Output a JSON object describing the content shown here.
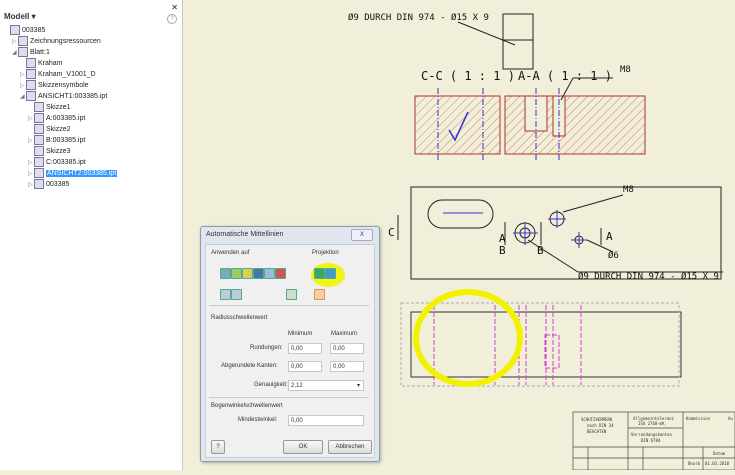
{
  "tree": {
    "header": "Modell",
    "items": [
      {
        "label": "003385",
        "indent": 0
      },
      {
        "label": "Zeichnungsressourcen",
        "indent": 1
      },
      {
        "label": "Blatt:1",
        "indent": 1
      },
      {
        "label": "Kraham",
        "indent": 2
      },
      {
        "label": "Kraham_V1001_D",
        "indent": 2
      },
      {
        "label": "Skizzensymbole",
        "indent": 2
      },
      {
        "label": "ANSICHT1:003385.ipt",
        "indent": 2
      },
      {
        "label": "Skizze1",
        "indent": 3
      },
      {
        "label": "A:003385.ipt",
        "indent": 3
      },
      {
        "label": "Skizze2",
        "indent": 3
      },
      {
        "label": "B:003385.ipt",
        "indent": 3
      },
      {
        "label": "Skizze3",
        "indent": 3
      },
      {
        "label": "C:003385.ipt",
        "indent": 3
      },
      {
        "label": "ANSICHT2:003385.ipt",
        "indent": 3,
        "selected": true
      },
      {
        "label": "003385",
        "indent": 3
      }
    ]
  },
  "drawing": {
    "note1": "Ø9 DURCH DIN 974 - Ø15 X 9",
    "section_cc": "C-C ( 1 : 1 )",
    "section_aa": "A-A ( 1 : 1 )",
    "thread1": "M8",
    "thread2": "M8",
    "label_a": "A",
    "label_a2": "A",
    "label_b": "B",
    "label_b2": "B",
    "label_c": "C",
    "dia6": "Ø6",
    "note2": "Ø9 DURCH DIN 974 - Ø15 X 9",
    "titleblock": {
      "c1": "SCHUTZVERMERK",
      "c1b": "nach DIN 34",
      "c1c": "BEACHTEN",
      "c2": "Allgemeintoleranz",
      "c2b": "ISO 2768-mK",
      "c3": "Verrundungskanten",
      "c3b": "DIN 6784",
      "c4": "Kommission",
      "c5": "Au",
      "datum": "Datum",
      "date": "01.03.2010",
      "bearb": "Bearb"
    }
  },
  "dialog": {
    "title": "Automatische Mittellinien",
    "close": "X",
    "apply_to": "Anwenden auf",
    "projection": "Projektion",
    "radius_threshold": "Radiusschwellenwert",
    "minimum": "Minimum",
    "maximum": "Maximum",
    "fillets_label": "Rundungen:",
    "fillets_min": "0,00",
    "fillets_max": "0,00",
    "rounded_label": "Abgerundete Kanten:",
    "rounded_min": "0,00",
    "rounded_max": "0,00",
    "precision_label": "Genauigkeit:",
    "precision_value": "2,12",
    "arc_threshold": "Bogenwinkelschwellenwert",
    "min_angle_label": "Mindestwinkel:",
    "min_angle": "0,00",
    "ok": "OK",
    "cancel": "Abbrechen"
  },
  "colors": {
    "highlight": "#f2f200",
    "hatch": "#c8654a",
    "centerline": "#d040d0",
    "selection": "#3399ff"
  }
}
